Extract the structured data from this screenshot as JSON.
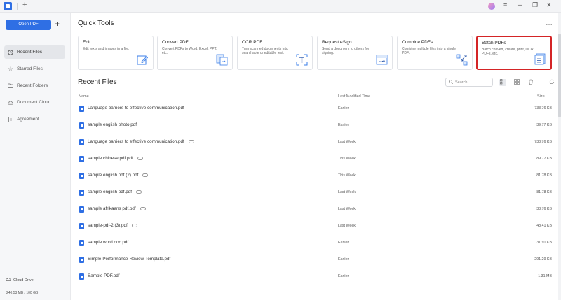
{
  "titlebar": {
    "new_tab_label": "+",
    "avatar_icon": "user-avatar-icon",
    "controls": [
      "≡",
      "─",
      "❐",
      "✕"
    ]
  },
  "sidebar": {
    "open_button": "Open PDF",
    "plus_label": "+",
    "items": [
      {
        "label": "Recent Files",
        "icon": "clock-icon",
        "active": true
      },
      {
        "label": "Starred Files",
        "icon": "star-icon"
      },
      {
        "label": "Recent Folders",
        "icon": "folder-icon"
      },
      {
        "label": "Document Cloud",
        "icon": "cloud-icon"
      },
      {
        "label": "Agreement",
        "icon": "document-icon"
      }
    ],
    "cloud_drive": "Cloud Drive",
    "storage": "240.53 MB / 100 GB"
  },
  "quick_tools": {
    "title": "Quick Tools",
    "more": "…",
    "cards": [
      {
        "title": "Edit",
        "desc": "Edit texts and images in a file."
      },
      {
        "title": "Convert PDF",
        "desc": "Convert PDFs to Word, Excel, PPT, etc."
      },
      {
        "title": "OCR PDF",
        "desc": "Turn scanned documents into searchable or editable text."
      },
      {
        "title": "Request eSign",
        "desc": "Send a document to others for signing."
      },
      {
        "title": "Combine PDFs",
        "desc": "Combine multiple files into a single PDF."
      },
      {
        "title": "Batch PDFs",
        "desc": "Batch convert, create, print, OCR PDFs, etc."
      }
    ]
  },
  "recent": {
    "title": "Recent Files",
    "search_placeholder": "Search",
    "col_name": "Name",
    "col_modified": "Last Modified Time",
    "col_size": "Size",
    "files": [
      {
        "name": "Language barriers to effective communication.pdf",
        "modified": "Earlier",
        "size": "733.76 KB",
        "cloud": false
      },
      {
        "name": "sample english photo.pdf",
        "modified": "Earlier",
        "size": "39.77 KB",
        "cloud": false
      },
      {
        "name": "Language barriers to effective communication.pdf",
        "modified": "Last Week",
        "size": "733.76 KB",
        "cloud": true
      },
      {
        "name": "sample chinese pdf.pdf",
        "modified": "This Week",
        "size": "89.77 KB",
        "cloud": true
      },
      {
        "name": "sample english pdf (2).pdf",
        "modified": "This Week",
        "size": "81.78 KB",
        "cloud": true
      },
      {
        "name": "sample english pdf.pdf",
        "modified": "Last Week",
        "size": "81.78 KB",
        "cloud": true
      },
      {
        "name": "sample afrikaans pdf.pdf",
        "modified": "Last Week",
        "size": "38.76 KB",
        "cloud": true
      },
      {
        "name": "sample-pdf-2 (3).pdf",
        "modified": "Last Week",
        "size": "48.41 KB",
        "cloud": true
      },
      {
        "name": "sample word doc.pdf",
        "modified": "Earlier",
        "size": "31.91 KB",
        "cloud": false
      },
      {
        "name": "Simple-Performance-Review-Template.pdf",
        "modified": "Earlier",
        "size": "291.29 KB",
        "cloud": false
      },
      {
        "name": "Sample PDF.pdf",
        "modified": "Earlier",
        "size": "1.31 MB",
        "cloud": false
      }
    ]
  }
}
